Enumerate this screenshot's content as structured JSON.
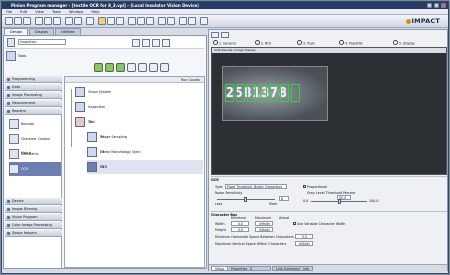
{
  "window": {
    "title": "Pinion Program manager - [textile OCR for 8_3.vpi] - (Local Insulator Vision Device)"
  },
  "menu": [
    "File",
    "Edit",
    "View",
    "Tools",
    "Window",
    "Help"
  ],
  "logo": "IMPACT",
  "tabs": [
    "Design",
    "Display",
    "Utilities"
  ],
  "inspection": {
    "label": "Inspection",
    "tool_label": "Tools"
  },
  "nav": {
    "categories": [
      "Programming",
      "Data",
      "Image Processing",
      "Measurement",
      "Readers"
    ],
    "reader_items": [
      "Barcode",
      "Character Contour Match",
      "DataMatrix",
      "OCR"
    ],
    "selected": "OCR",
    "more_categories": [
      "Device",
      "Image Filtering",
      "Vision Program",
      "Color Image Processing",
      "Shape Helpers"
    ]
  },
  "tree": {
    "header": "Run Counts",
    "nodes": [
      {
        "label": "Vision System",
        "count": ""
      },
      {
        "label": "Inspection",
        "count": ""
      },
      {
        "label": "Task",
        "count": "75"
      },
      {
        "label": "Image Sampling",
        "count": "75"
      },
      {
        "label": "Linear Morphology Open",
        "count": "75"
      },
      {
        "label": "OCR",
        "count": "75"
      }
    ]
  },
  "display": {
    "radios": [
      "1. General",
      "2. ROI",
      "3. Train",
      "4. Pass/Fail",
      "5. Display"
    ],
    "image_title": "OCR Results: Image Display",
    "ocr_text": "2581378"
  },
  "ocr": {
    "section": "OCR",
    "type_label": "Type",
    "type_value": "Fixed Threshold, Bright Characters",
    "proportional": "Proportional",
    "noise_label": "Noise Sensitivity",
    "noise_min": "Less",
    "noise_max": "More",
    "noise_value": "8",
    "grey_label": "Grey Level Threshold Percent",
    "grey_value": "50.0",
    "grey_min": "0.0",
    "grey_max": "100.0"
  },
  "charbox": {
    "section": "Character Box",
    "col_min": "Minimum",
    "col_max": "Maximum",
    "col_actual": "Actual",
    "width_label": "Width",
    "height_label": "Height",
    "width_min": "0.0",
    "width_max": "Infinity",
    "height_min": "0.0",
    "height_max": "Infinity",
    "var_width": "Use Variable Character Width",
    "min_hspace_label": "Minimum Horizontal Space Between Characters",
    "min_hspace": "0.0",
    "max_vspace_label": "Maximum Vertical Space Within Characters",
    "max_vspace": "Infinity"
  },
  "bottom_tabs": [
    "Setup",
    "Properties",
    "",
    "Link Summary",
    "Info"
  ]
}
